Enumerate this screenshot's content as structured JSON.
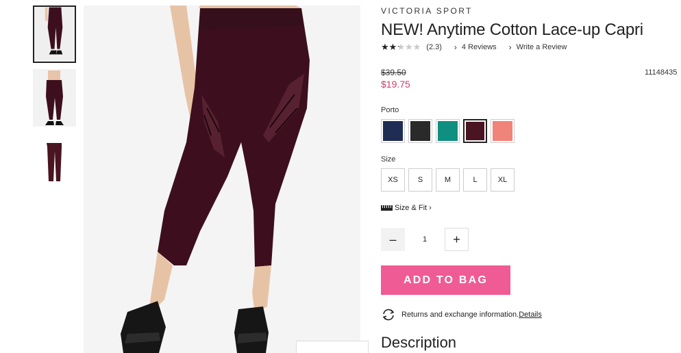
{
  "thumbnails": [
    {
      "icon": "model-front-leggings-thumbnail"
    },
    {
      "icon": "model-back-leggings-thumbnail"
    },
    {
      "icon": "leggings-flat-thumbnail"
    }
  ],
  "main_image": {
    "icon": "model-wearing-capri-leggings-image"
  },
  "product": {
    "brand": "VICTORIA SPORT",
    "title": "NEW! Anytime Cotton Lace-up Capri",
    "rating": {
      "value": 2.3,
      "stars_filled": 2.3,
      "stars_total": 5,
      "label": "(2.3)",
      "reviews_label": "4 Reviews",
      "write_label": "Write a Review"
    },
    "old_price": "$39.50",
    "sale_price": "$19.75",
    "sku": "11148435"
  },
  "color": {
    "label": "Porto",
    "swatches": [
      {
        "name": "navy",
        "hex": "#1f2d55"
      },
      {
        "name": "black",
        "hex": "#2a2a2a"
      },
      {
        "name": "teal",
        "hex": "#0f8f7f"
      },
      {
        "name": "porto",
        "hex": "#4a1422",
        "selected": true
      },
      {
        "name": "coral",
        "hex": "#f0837a"
      }
    ]
  },
  "size": {
    "label": "Size",
    "options": [
      "XS",
      "S",
      "M",
      "L",
      "XL"
    ]
  },
  "size_fit": {
    "label": "Size & Fit"
  },
  "quantity": {
    "value": "1",
    "minus": "–",
    "plus": "+"
  },
  "add_to_bag": {
    "label": "ADD TO BAG",
    "color": "#ef5b95"
  },
  "returns": {
    "text": "Returns and exchange information.",
    "link": "Details"
  },
  "description": {
    "heading": "Description"
  },
  "colors": {
    "sale": "#d43a6a",
    "legging": "#3d0f1e"
  }
}
